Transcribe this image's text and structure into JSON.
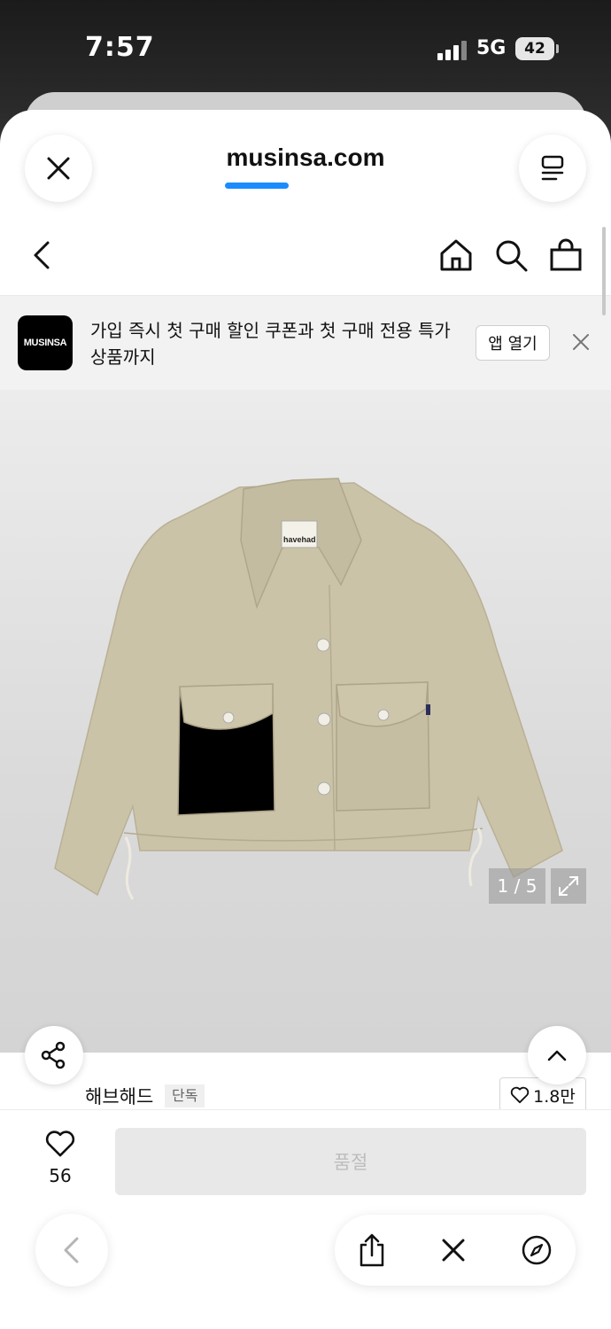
{
  "status_bar": {
    "time": "7:57",
    "network": "5G",
    "battery": "42"
  },
  "browser": {
    "domain": "musinsa.com"
  },
  "app_banner": {
    "logo_text": "MUSINSA",
    "message": "가입 즉시 첫 구매 할인 쿠폰과 첫 구매 전용 특가 상품까지",
    "open_app_label": "앱 열기"
  },
  "product": {
    "image_counter": "1 / 5",
    "image_label": "havehad",
    "brand_name": "해브해드",
    "exclusive_badge": "단독",
    "brand_likes": "1.8만",
    "wish_count": "56",
    "buy_button_label": "품절"
  },
  "colors": {
    "accent_blue": "#1a8cff",
    "jacket": "#cbc3a8",
    "soldout_bg": "#e8e8e8",
    "soldout_text": "#bdbdbd"
  }
}
